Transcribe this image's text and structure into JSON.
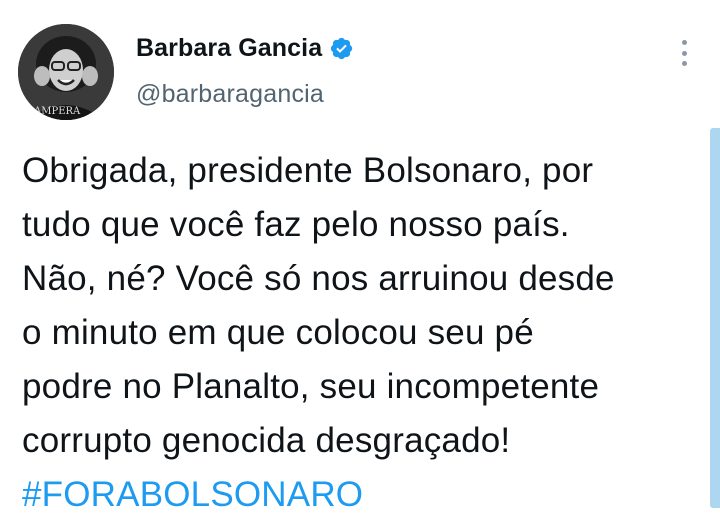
{
  "tweet": {
    "author": {
      "display_name": "Barbara Gancia",
      "handle": "@barbaragancia",
      "verified": true,
      "avatar_icon": "profile-photo"
    },
    "text_lines": [
      "Obrigada, presidente Bolsonaro, por",
      "tudo que você faz pelo nosso país.",
      "Não, né? Você só nos arruinou desde",
      "o minuto em que colocou seu pé",
      "podre no Planalto, seu incompetente",
      "corrupto genocida desgraçado!"
    ],
    "hashtag": "#FORABOLSONARO",
    "more_icon": "more-vertical-icon"
  },
  "colors": {
    "text": "#0f1419",
    "secondary_text": "#536471",
    "accent": "#1d9bf0",
    "verified_badge": "#1d9bf0"
  }
}
